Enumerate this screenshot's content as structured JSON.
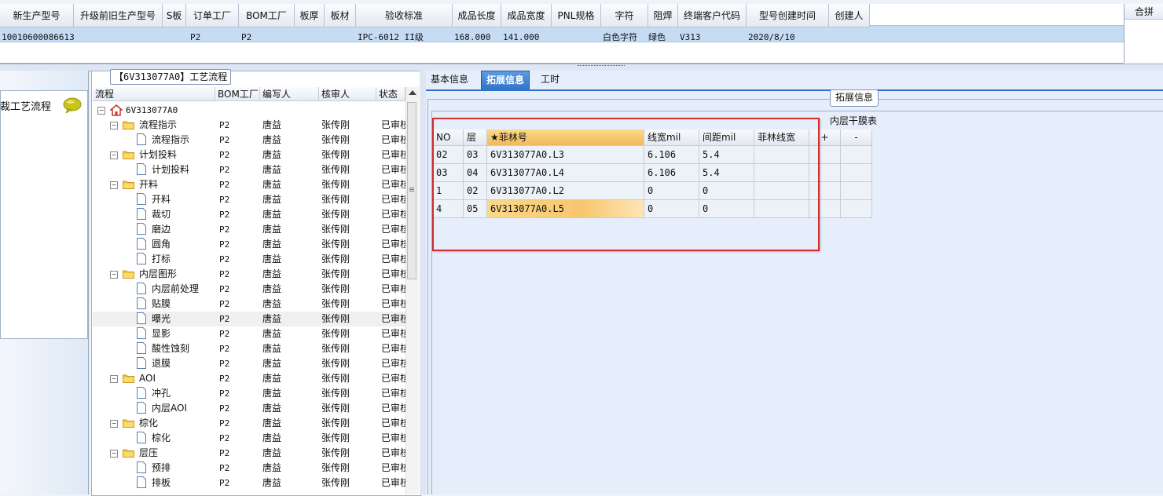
{
  "top_grid": {
    "headers": [
      "新生产型号",
      "升级前旧生产型号",
      "S板",
      "订单工厂",
      "BOM工厂",
      "板厚",
      "板材",
      "验收标准",
      "成品长度",
      "成品宽度",
      "PNL规格",
      "字符",
      "阻焊",
      "终端客户代码",
      "型号创建时间",
      "创建人"
    ],
    "row": [
      "10010600086613",
      "",
      "",
      "P2",
      "P2",
      "",
      "",
      "IPC-6012 II级",
      "168.000",
      "141.000",
      "",
      "白色字符",
      "绿色",
      "V313",
      "2020/8/10",
      ""
    ],
    "right_header": "合拼"
  },
  "left_panel": {
    "label": "裁工艺流程"
  },
  "process_panel": {
    "title": "【6V313077A0】工艺流程",
    "headers": [
      "流程",
      "BOM工厂",
      "编写人",
      "核审人",
      "状态"
    ],
    "root": "6V313077A0",
    "rows": [
      {
        "name": "流程指示",
        "level": 1,
        "type": "folder",
        "bom": "P2",
        "writer": "唐益",
        "reviewer": "张传刚",
        "status": "已审核"
      },
      {
        "name": "流程指示",
        "level": 2,
        "type": "doc",
        "bom": "P2",
        "writer": "唐益",
        "reviewer": "张传刚",
        "status": "已审核"
      },
      {
        "name": "计划投料",
        "level": 1,
        "type": "folder",
        "bom": "P2",
        "writer": "唐益",
        "reviewer": "张传刚",
        "status": "已审核"
      },
      {
        "name": "计划投料",
        "level": 2,
        "type": "doc",
        "bom": "P2",
        "writer": "唐益",
        "reviewer": "张传刚",
        "status": "已审核"
      },
      {
        "name": "开料",
        "level": 1,
        "type": "folder",
        "bom": "P2",
        "writer": "唐益",
        "reviewer": "张传刚",
        "status": "已审核"
      },
      {
        "name": "开料",
        "level": 2,
        "type": "doc",
        "bom": "P2",
        "writer": "唐益",
        "reviewer": "张传刚",
        "status": "已审核"
      },
      {
        "name": "裁切",
        "level": 2,
        "type": "doc",
        "bom": "P2",
        "writer": "唐益",
        "reviewer": "张传刚",
        "status": "已审核"
      },
      {
        "name": "磨边",
        "level": 2,
        "type": "doc",
        "bom": "P2",
        "writer": "唐益",
        "reviewer": "张传刚",
        "status": "已审核"
      },
      {
        "name": "圆角",
        "level": 2,
        "type": "doc",
        "bom": "P2",
        "writer": "唐益",
        "reviewer": "张传刚",
        "status": "已审核"
      },
      {
        "name": "打标",
        "level": 2,
        "type": "doc",
        "bom": "P2",
        "writer": "唐益",
        "reviewer": "张传刚",
        "status": "已审核"
      },
      {
        "name": "内层图形",
        "level": 1,
        "type": "folder",
        "bom": "P2",
        "writer": "唐益",
        "reviewer": "张传刚",
        "status": "已审核"
      },
      {
        "name": "内层前处理",
        "level": 2,
        "type": "doc",
        "bom": "P2",
        "writer": "唐益",
        "reviewer": "张传刚",
        "status": "已审核"
      },
      {
        "name": "贴膜",
        "level": 2,
        "type": "doc",
        "bom": "P2",
        "writer": "唐益",
        "reviewer": "张传刚",
        "status": "已审核"
      },
      {
        "name": "曝光",
        "level": 2,
        "type": "doc",
        "bom": "P2",
        "writer": "唐益",
        "reviewer": "张传刚",
        "status": "已审核",
        "selected": true
      },
      {
        "name": "显影",
        "level": 2,
        "type": "doc",
        "bom": "P2",
        "writer": "唐益",
        "reviewer": "张传刚",
        "status": "已审核"
      },
      {
        "name": "酸性蚀刻",
        "level": 2,
        "type": "doc",
        "bom": "P2",
        "writer": "唐益",
        "reviewer": "张传刚",
        "status": "已审核"
      },
      {
        "name": "退膜",
        "level": 2,
        "type": "doc",
        "bom": "P2",
        "writer": "唐益",
        "reviewer": "张传刚",
        "status": "已审核"
      },
      {
        "name": "AOI",
        "level": 1,
        "type": "folder",
        "bom": "P2",
        "writer": "唐益",
        "reviewer": "张传刚",
        "status": "已审核"
      },
      {
        "name": "冲孔",
        "level": 2,
        "type": "doc",
        "bom": "P2",
        "writer": "唐益",
        "reviewer": "张传刚",
        "status": "已审核"
      },
      {
        "name": "内层AOI",
        "level": 2,
        "type": "doc",
        "bom": "P2",
        "writer": "唐益",
        "reviewer": "张传刚",
        "status": "已审核"
      },
      {
        "name": "棕化",
        "level": 1,
        "type": "folder",
        "bom": "P2",
        "writer": "唐益",
        "reviewer": "张传刚",
        "status": "已审核"
      },
      {
        "name": "棕化",
        "level": 2,
        "type": "doc",
        "bom": "P2",
        "writer": "唐益",
        "reviewer": "张传刚",
        "status": "已审核"
      },
      {
        "name": "层压",
        "level": 1,
        "type": "folder",
        "bom": "P2",
        "writer": "唐益",
        "reviewer": "张传刚",
        "status": "已审核"
      },
      {
        "name": "预排",
        "level": 2,
        "type": "doc",
        "bom": "P2",
        "writer": "唐益",
        "reviewer": "张传刚",
        "status": "已审核"
      },
      {
        "name": "排板",
        "level": 2,
        "type": "doc",
        "bom": "P2",
        "writer": "唐益",
        "reviewer": "张传刚",
        "status": "已审核"
      }
    ]
  },
  "tabs": [
    {
      "label": "基本信息",
      "active": false
    },
    {
      "label": "拓展信息",
      "active": true
    },
    {
      "label": "工时",
      "active": false
    }
  ],
  "ext_panel": {
    "group_title": "拓展信息",
    "inner_title": "内层干膜表",
    "headers": [
      "NO",
      "层",
      "★菲林号",
      "线宽mil",
      "间距mil",
      "菲林线宽",
      "+",
      "-"
    ],
    "rows": [
      [
        "02",
        "03",
        "6V313077A0.L3",
        "6.106",
        "5.4",
        ""
      ],
      [
        "03",
        "04",
        "6V313077A0.L4",
        "6.106",
        "5.4",
        ""
      ],
      [
        "1",
        "02",
        "6V313077A0.L2",
        "0",
        "0",
        ""
      ],
      [
        "4",
        "05",
        "6V313077A0.L5",
        "0",
        "0",
        ""
      ]
    ],
    "selected_row": 3
  },
  "colors": {
    "accent": "#2f73c8",
    "selection": "#c6dcf5",
    "highlight": "#f7c66e",
    "annotation_box": "#d42b2b"
  }
}
